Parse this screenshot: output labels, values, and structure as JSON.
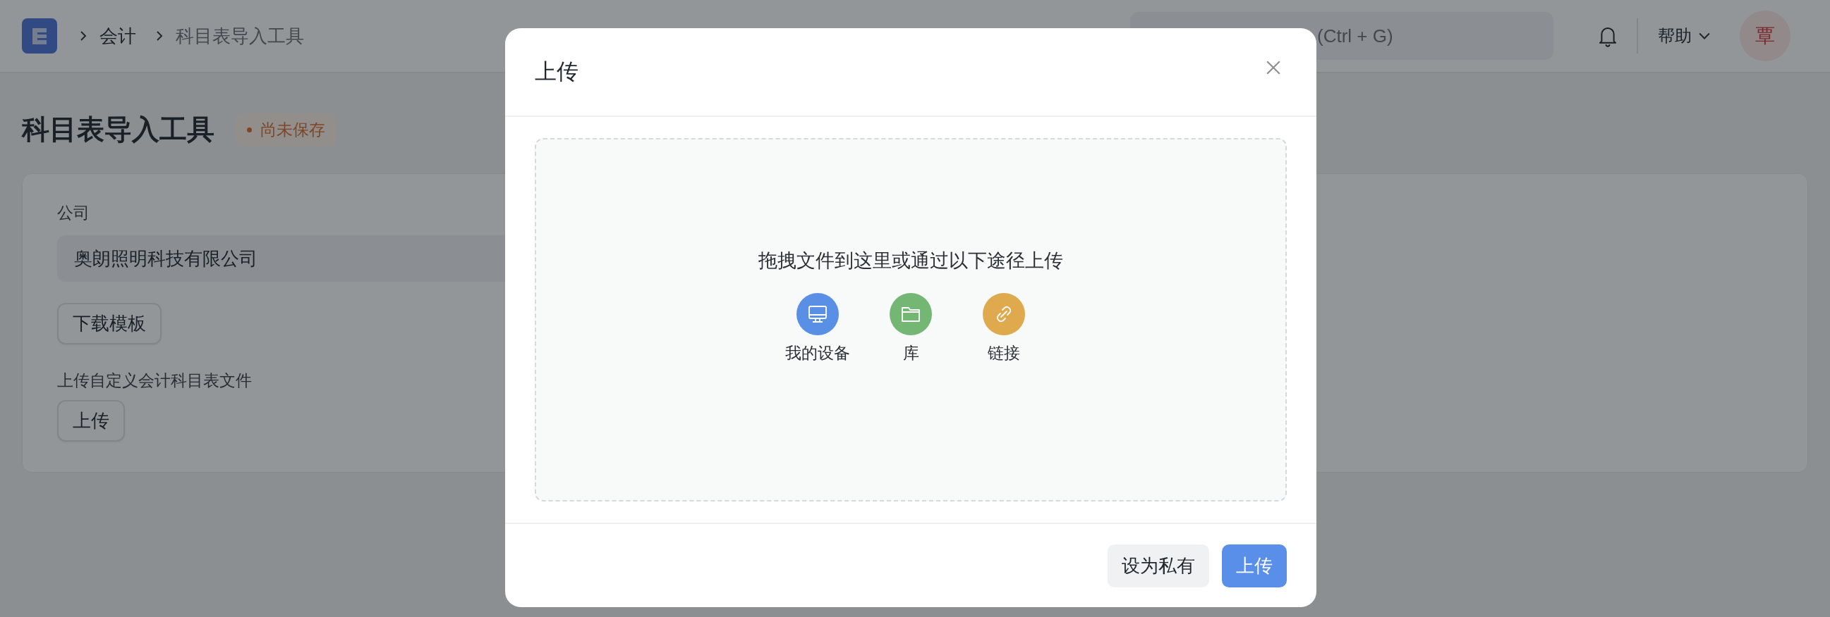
{
  "topbar": {
    "breadcrumbs": [
      {
        "label": "会计"
      },
      {
        "label": "科目表导入工具"
      }
    ],
    "search": {
      "placeholder": "(Ctrl + G)"
    },
    "help": "帮助",
    "avatar": "覃"
  },
  "page": {
    "title": "科目表导入工具",
    "status": "尚未保存"
  },
  "form": {
    "company_label": "公司",
    "company_value": "奥朗照明科技有限公司",
    "download_button": "下载模板",
    "upload_label": "上传自定义会计科目表文件",
    "upload_button": "上传"
  },
  "modal": {
    "title": "上传",
    "drop_text": "拖拽文件到这里或通过以下途径上传",
    "sources": [
      {
        "label": "我的设备",
        "kind": "device",
        "color": "#5a8fe6"
      },
      {
        "label": "库",
        "kind": "library",
        "color": "#74b775"
      },
      {
        "label": "链接",
        "kind": "link",
        "color": "#dfa94e"
      }
    ],
    "buttons": [
      {
        "label": "设为私有",
        "kind": "secondary"
      },
      {
        "label": "上传",
        "kind": "primary"
      }
    ]
  }
}
